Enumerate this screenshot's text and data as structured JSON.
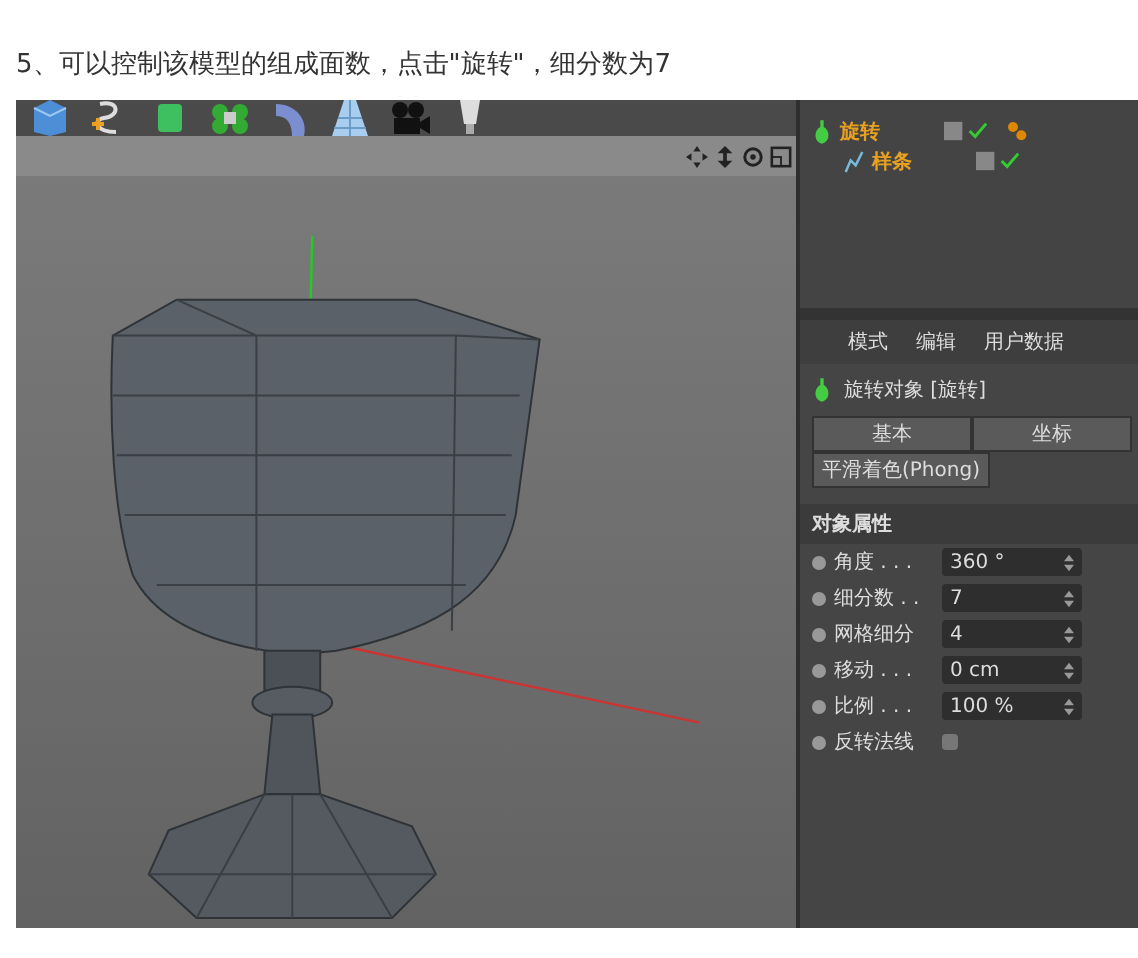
{
  "caption": "5、可以控制该模型的组成面数，点击\"旋转\"，细分数为7",
  "objects": [
    {
      "name": "旋转",
      "children": [
        {
          "name": "样条"
        }
      ]
    }
  ],
  "attributes": {
    "menu": [
      "模式",
      "编辑",
      "用户数据"
    ],
    "title": "旋转对象 [旋转]",
    "tabs": [
      "基本",
      "坐标",
      "平滑着色(Phong)"
    ],
    "section": "对象属性",
    "fields": [
      {
        "kind": "number",
        "label": "角度 . . .",
        "value": "360 °"
      },
      {
        "kind": "number",
        "label": "细分数 . .",
        "value": "7"
      },
      {
        "kind": "number",
        "label": "网格细分",
        "value": "4"
      },
      {
        "kind": "number",
        "label": "移动 . . .",
        "value": "0 cm"
      },
      {
        "kind": "number",
        "label": "比例 . . .",
        "value": "100 %"
      },
      {
        "kind": "checkbox",
        "label": "反转法线",
        "checked": false
      }
    ]
  }
}
